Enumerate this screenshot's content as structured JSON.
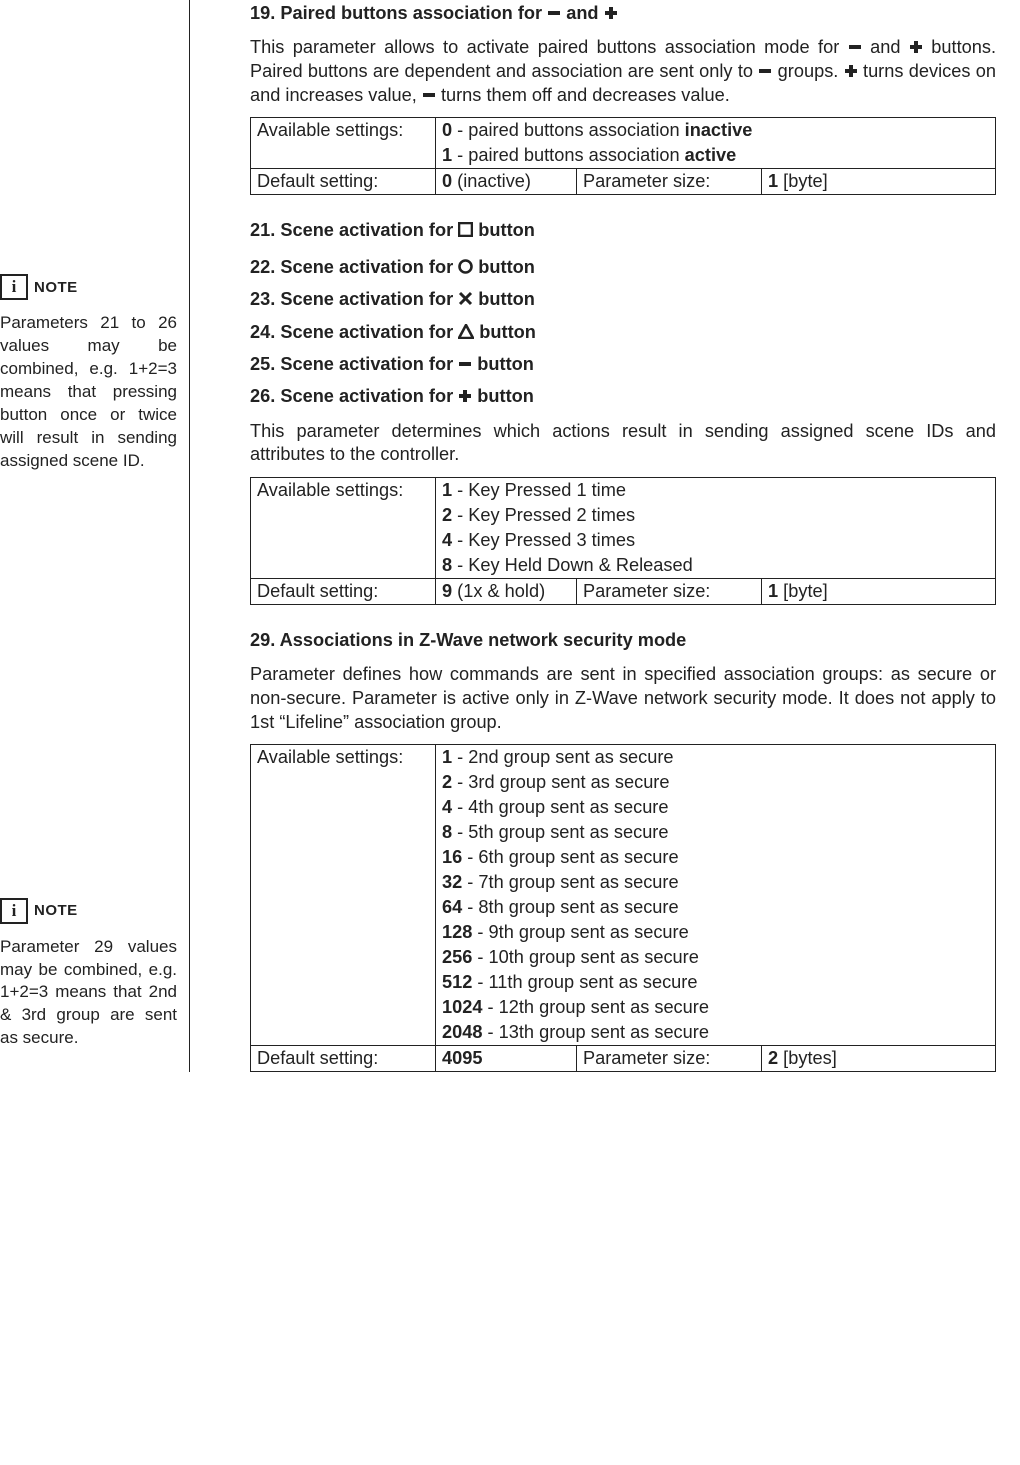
{
  "sidebar": {
    "note1": {
      "label": "NOTE",
      "body": "Parameters 21 to 26 values may be combined, e.g. 1+2=3 means that pressing button once or twice will result in sending assigned scene ID."
    },
    "note2": {
      "label": "NOTE",
      "body": "Parameter 29 values may be combined, e.g. 1+2=3 means that 2nd & 3rd group are sent as secure."
    }
  },
  "p19": {
    "title_a": "19. Paired buttons association for ",
    "title_b": " and ",
    "desc_a": "This parameter allows to activate paired buttons association mode for ",
    "desc_b": " and ",
    "desc_c": " buttons. Paired buttons are dependent and association are sent only to ",
    "desc_d": " groups. ",
    "desc_e": " turns devices on and increases value, ",
    "desc_f": " turns them off and decreases value.",
    "avail_label": "Available settings:",
    "opt0_v": "0",
    "opt0_mid": " - paired buttons association ",
    "opt0_state": "inactive",
    "opt1_v": "1",
    "opt1_mid": " - paired buttons association ",
    "opt1_state": "active",
    "default_label": "Default setting:",
    "default_v": "0",
    "default_note": " (inactive)",
    "psize_label": "Parameter size:",
    "psize_v": "1",
    "psize_unit": " [byte]"
  },
  "p21": {
    "t_a": "21. Scene activation for ",
    "t_b": " button"
  },
  "p22": {
    "t_a": "22. Scene activation for ",
    "t_b": " button"
  },
  "p23": {
    "t_a": "23. Scene activation for ",
    "t_b": " button"
  },
  "p24": {
    "t_a": "24. Scene activation for ",
    "t_b": " button"
  },
  "p25": {
    "t_a": "25. Scene activation for ",
    "t_b": " button"
  },
  "p26": {
    "t_a": "26. Scene activation for ",
    "t_b": " button"
  },
  "scene": {
    "desc": "This parameter determines which actions result in sending assigned scene IDs and attributes to the controller.",
    "avail_label": "Available settings:",
    "o1v": "1",
    "o1t": " - Key Pressed 1 time",
    "o2v": "2",
    "o2t": " - Key Pressed 2 times",
    "o3v": "4",
    "o3t": " - Key Pressed 3 times",
    "o4v": "8",
    "o4t": " - Key Held Down & Released",
    "default_label": "Default setting:",
    "default_v": "9",
    "default_note": " (1x & hold)",
    "psize_label": "Parameter size:",
    "psize_v": "1",
    "psize_unit": " [byte]"
  },
  "p29": {
    "title": "29. Associations in Z-Wave network security mode",
    "desc": "Parameter defines how commands are sent in specified association groups: as secure or non-secure. Parameter is active only in Z-Wave network security mode. It does not apply to 1st “Lifeline” association group.",
    "avail_label": "Available settings:",
    "v1": "1",
    "t1": " - 2nd group sent as secure",
    "v2": "2",
    "t2": " - 3rd group sent as secure",
    "v3": "4",
    "t3": " - 4th group sent as secure",
    "v4": "8",
    "t4": " - 5th group sent as secure",
    "v5": "16",
    "t5": " - 6th group sent as secure",
    "v6": "32",
    "t6": " - 7th group sent as secure",
    "v7": "64",
    "t7": " - 8th group sent as secure",
    "v8": "128",
    "t8": " - 9th group sent as secure",
    "v9": "256",
    "t9": " - 10th group sent as secure",
    "v10": "512",
    "t10": " - 11th group sent as secure",
    "v11": "1024",
    "t11": " - 12th group sent as secure",
    "v12": "2048",
    "t12": " - 13th group sent as secure",
    "default_label": "Default setting:",
    "default_v": "4095",
    "psize_label": "Parameter size:",
    "psize_v": "2",
    "psize_unit": " [bytes]"
  }
}
